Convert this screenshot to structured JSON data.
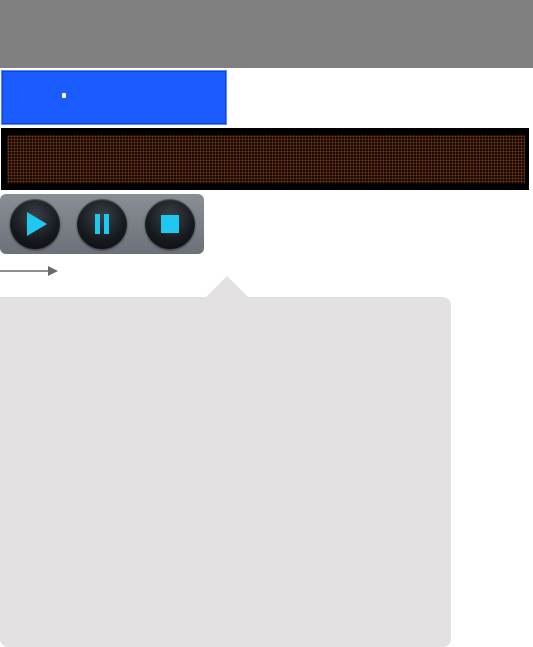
{
  "window": {
    "title_bar": ""
  },
  "display": {
    "text": ""
  },
  "transport": {
    "play_icon": "play-icon",
    "pause_icon": "pause-icon",
    "stop_icon": "stop-icon",
    "icon_color": "#1ec8f0"
  },
  "popover": {
    "content": ""
  },
  "colors": {
    "top_bar": "#808080",
    "selection_blue": "#1a5cff",
    "led_amber": "#7a3a10",
    "popover_bg": "#e2e0e1"
  }
}
